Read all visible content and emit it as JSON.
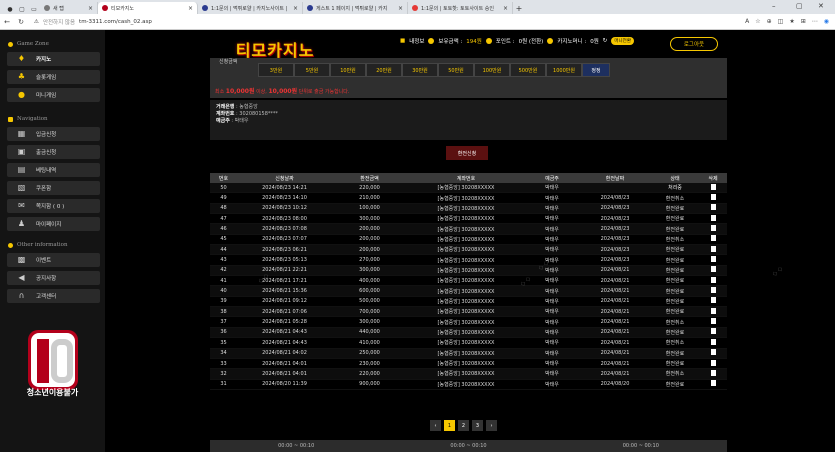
{
  "browser": {
    "tabs": [
      {
        "title": "새 탭",
        "active": false,
        "color": "#777777"
      },
      {
        "title": "티모카지노",
        "active": true,
        "color": "#b3001b"
      },
      {
        "title": "1:1문의 | 먹튀로얄 | 카지노사이트 |",
        "active": false,
        "color": "#2a3a8f"
      },
      {
        "title": "게스트 1 페이지 | 먹튀로얄 | 카지",
        "active": false,
        "color": "#2a3a8f"
      },
      {
        "title": "1:1문의 | 토토핫: 토토사이트 승인",
        "active": false,
        "color": "#e53935"
      }
    ],
    "url_insecure": "안전하지 않음",
    "url": "tm-3311.com/cash_02.asp"
  },
  "sidebar": {
    "game_zone": "Game Zone",
    "game_items": [
      {
        "label": "카지노",
        "icon": "casino-chip-icon",
        "glyph": "♦",
        "color": "#f6c700",
        "active": true
      },
      {
        "label": "슬롯게임",
        "icon": "slot-bell-icon",
        "glyph": "♣",
        "color": "#f6c700",
        "active": false
      },
      {
        "label": "미니게임",
        "icon": "gamepad-icon",
        "glyph": "●",
        "color": "#f6c700",
        "active": false
      }
    ],
    "navigation": "Navigation",
    "nav_items": [
      {
        "label": "입금신청",
        "icon": "deposit-icon",
        "glyph": "▦"
      },
      {
        "label": "출금신청",
        "icon": "withdraw-icon",
        "glyph": "▣"
      },
      {
        "label": "베팅내역",
        "icon": "betting-history-icon",
        "glyph": "▤"
      },
      {
        "label": "쿠폰함",
        "icon": "coupon-icon",
        "glyph": "▧"
      },
      {
        "label": "쪽지함 ( 0 )",
        "icon": "mail-icon",
        "glyph": "✉"
      },
      {
        "label": "마이페이지",
        "icon": "user-icon",
        "glyph": "♟"
      }
    ],
    "other_information": "Other information",
    "other_items": [
      {
        "label": "이벤트",
        "icon": "gift-icon",
        "glyph": "▩"
      },
      {
        "label": "공지사항",
        "icon": "megaphone-icon",
        "glyph": "◀"
      },
      {
        "label": "고객센터",
        "icon": "headset-icon",
        "glyph": "∩"
      }
    ],
    "age_label": "청소년이용불가"
  },
  "header": {
    "brand": "티모카지노",
    "my_info": "내정보",
    "holding_label": "보유금액 : ",
    "holding_value": "194원",
    "point_label": "포인트 : ",
    "point_value": "0원 (전환)",
    "casino_money_label": "카지노머니 : ",
    "casino_money_value": "0원",
    "convert_badge": "머니전환",
    "logout": "로그아웃"
  },
  "amount": {
    "label": "신청금액",
    "buttons": [
      "3만원",
      "5만원",
      "10만원",
      "20만원",
      "30만원",
      "50만원",
      "100만원",
      "500만원",
      "1000만원"
    ],
    "reset": "정정",
    "note_pre": "최소 ",
    "note_amount1": "10,000원",
    "note_mid": " 이상, ",
    "note_amount2": "10,000원",
    "note_post": " 단위로 출금 가능합니다."
  },
  "bank": {
    "bank_label": "거래은행",
    "bank_value": " : 농협중앙",
    "account_label": "계좌번호",
    "account_value": " : 302080158****",
    "holder_label": "예금주",
    "holder_value": " : 박태우"
  },
  "apply_button": "환전신청",
  "table": {
    "headers": [
      "번호",
      "신청날짜",
      "환전금액",
      "계좌번호",
      "예금주",
      "환전날짜",
      "상태",
      "삭제"
    ],
    "rows": [
      [
        "50",
        "2024/08/23 14:21",
        "220,000",
        "[농협중앙] 30208XXXXX",
        "박태우",
        "",
        "처리중"
      ],
      [
        "49",
        "2024/08/23 14:10",
        "210,000",
        "[농협중앙] 30208XXXXX",
        "박태우",
        "2024/08/23",
        "환전취소"
      ],
      [
        "48",
        "2024/08/23 10:12",
        "100,000",
        "[농협중앙] 30208XXXXX",
        "박태우",
        "2024/08/23",
        "환전완료"
      ],
      [
        "47",
        "2024/08/23 08:00",
        "300,000",
        "[농협중앙] 30208XXXXX",
        "박태우",
        "2024/08/23",
        "환전완료"
      ],
      [
        "46",
        "2024/08/23 07:08",
        "200,000",
        "[농협중앙] 30208XXXXX",
        "박태우",
        "2024/08/23",
        "환전완료"
      ],
      [
        "45",
        "2024/08/23 07:07",
        "200,000",
        "[농협중앙] 30208XXXXX",
        "박태우",
        "2024/08/23",
        "환전취소"
      ],
      [
        "44",
        "2024/08/23 06:21",
        "200,000",
        "[농협중앙] 30208XXXXX",
        "박태우",
        "2024/08/23",
        "환전완료"
      ],
      [
        "43",
        "2024/08/23 05:13",
        "270,000",
        "[농협중앙] 30208XXXXX",
        "박태우",
        "2024/08/23",
        "환전완료"
      ],
      [
        "42",
        "2024/08/21 22:21",
        "300,000",
        "[농협중앙] 30208XXXXX",
        "박태우",
        "2024/08/21",
        "환전완료"
      ],
      [
        "41",
        "2024/08/21 17:21",
        "400,000",
        "[농협중앙] 30208XXXXX",
        "박태우",
        "2024/08/21",
        "환전완료"
      ],
      [
        "40",
        "2024/08/21 15:36",
        "600,000",
        "[농협중앙] 30208XXXXX",
        "박태우",
        "2024/08/21",
        "환전완료"
      ],
      [
        "39",
        "2024/08/21 09:12",
        "500,000",
        "[농협중앙] 30208XXXXX",
        "박태우",
        "2024/08/21",
        "환전완료"
      ],
      [
        "38",
        "2024/08/21 07:06",
        "700,000",
        "[농협중앙] 30208XXXXX",
        "박태우",
        "2024/08/21",
        "환전완료"
      ],
      [
        "37",
        "2024/08/21 05:28",
        "300,000",
        "[농협중앙] 30208XXXXX",
        "박태우",
        "2024/08/21",
        "환전취소"
      ],
      [
        "36",
        "2024/08/21 04:43",
        "440,000",
        "[농협중앙] 30208XXXXX",
        "박태우",
        "2024/08/21",
        "환전완료"
      ],
      [
        "35",
        "2024/08/21 04:43",
        "410,000",
        "[농협중앙] 30208XXXXX",
        "박태우",
        "2024/08/21",
        "환전취소"
      ],
      [
        "34",
        "2024/08/21 04:02",
        "250,000",
        "[농협중앙] 30208XXXXX",
        "박태우",
        "2024/08/21",
        "환전완료"
      ],
      [
        "33",
        "2024/08/21 04:01",
        "230,000",
        "[농협중앙] 30208XXXXX",
        "박태우",
        "2024/08/21",
        "환전완료"
      ],
      [
        "32",
        "2024/08/21 04:01",
        "220,000",
        "[농협중앙] 30208XXXXX",
        "박태우",
        "2024/08/21",
        "환전취소"
      ],
      [
        "31",
        "2024/08/20 11:39",
        "900,000",
        "[농협중앙] 30208XXXXX",
        "박태우",
        "2024/08/20",
        "환전완료"
      ]
    ]
  },
  "pagination": {
    "prev": "‹",
    "pages": [
      "1",
      "2",
      "3"
    ],
    "current": "1",
    "next": "›"
  },
  "footer": [
    "00:00 ~ 00:10",
    "00:00 ~ 00:10",
    "00:00 ~ 00:10"
  ]
}
